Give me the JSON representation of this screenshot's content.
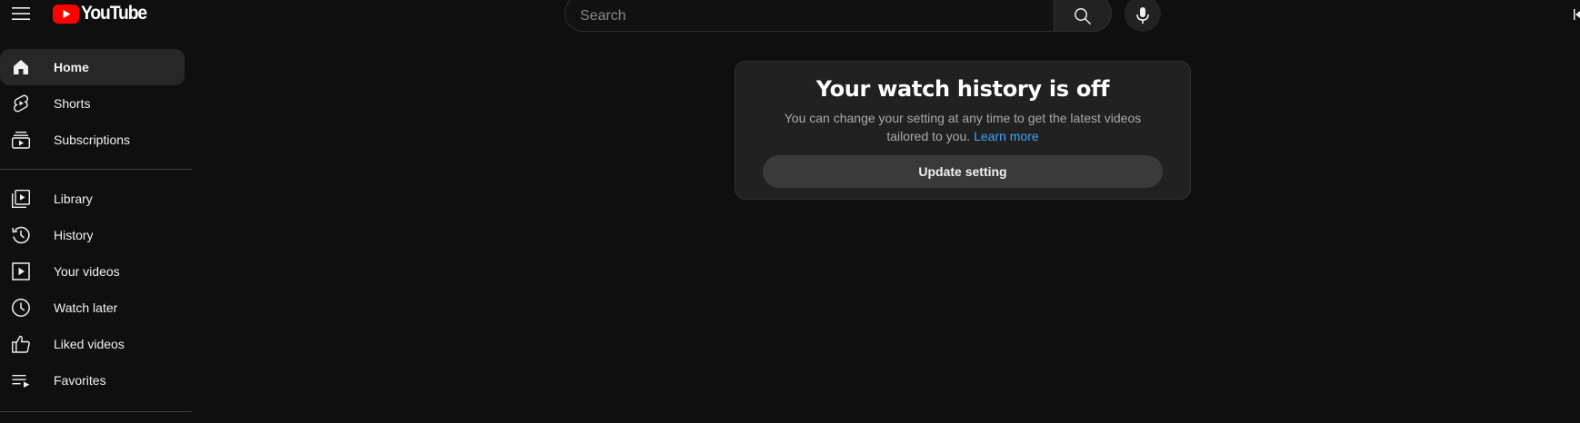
{
  "header": {
    "logo_text": "YouTube",
    "search": {
      "placeholder": "Search",
      "value": ""
    },
    "icons": {
      "menu": "hamburger-menu-icon",
      "search": "search-icon",
      "mic": "microphone-icon",
      "edge": "sign-in-icon"
    }
  },
  "sidebar": {
    "section1": [
      {
        "label": "Home",
        "icon": "home-icon",
        "active": true
      },
      {
        "label": "Shorts",
        "icon": "shorts-icon",
        "active": false
      },
      {
        "label": "Subscriptions",
        "icon": "subscriptions-icon",
        "active": false
      }
    ],
    "section2": [
      {
        "label": "Library",
        "icon": "library-icon"
      },
      {
        "label": "History",
        "icon": "history-icon"
      },
      {
        "label": "Your videos",
        "icon": "your-videos-icon"
      },
      {
        "label": "Watch later",
        "icon": "watch-later-icon"
      },
      {
        "label": "Liked videos",
        "icon": "liked-videos-icon"
      },
      {
        "label": "Favorites",
        "icon": "playlist-icon"
      }
    ]
  },
  "main": {
    "card": {
      "title": "Your watch history is off",
      "body": "You can change your setting at any time to get the latest videos tailored to you.",
      "link": "Learn more",
      "button": "Update setting"
    }
  },
  "colors": {
    "background": "#0f0f0f",
    "card": "#212121",
    "accent_red": "#ff0000",
    "link_blue": "#3ea6ff",
    "active_item": "#272727"
  }
}
